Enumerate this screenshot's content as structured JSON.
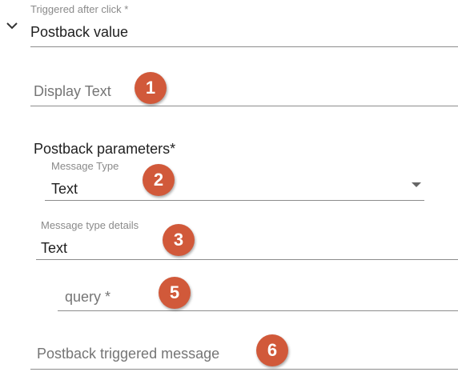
{
  "postback_value_field": {
    "label": "Triggered after click *",
    "value": "Postback value"
  },
  "display_text_field": {
    "placeholder": "Display Text"
  },
  "postback_parameters": {
    "heading": "Postback parameters*",
    "message_type": {
      "label": "Message Type",
      "value": "Text"
    },
    "message_type_details": {
      "label": "Message type details",
      "value": "Text"
    },
    "query": {
      "placeholder": "query *"
    }
  },
  "postback_triggered_message_field": {
    "placeholder": "Postback triggered message"
  },
  "badges": [
    "1",
    "2",
    "3",
    "5",
    "6"
  ],
  "colors": {
    "badge": "#d1593a",
    "underline": "#8c8c8c",
    "label": "#8a8a8a"
  },
  "icons": {
    "collapse": "chevron-down-icon",
    "dropdown": "dropdown-arrow-icon"
  }
}
